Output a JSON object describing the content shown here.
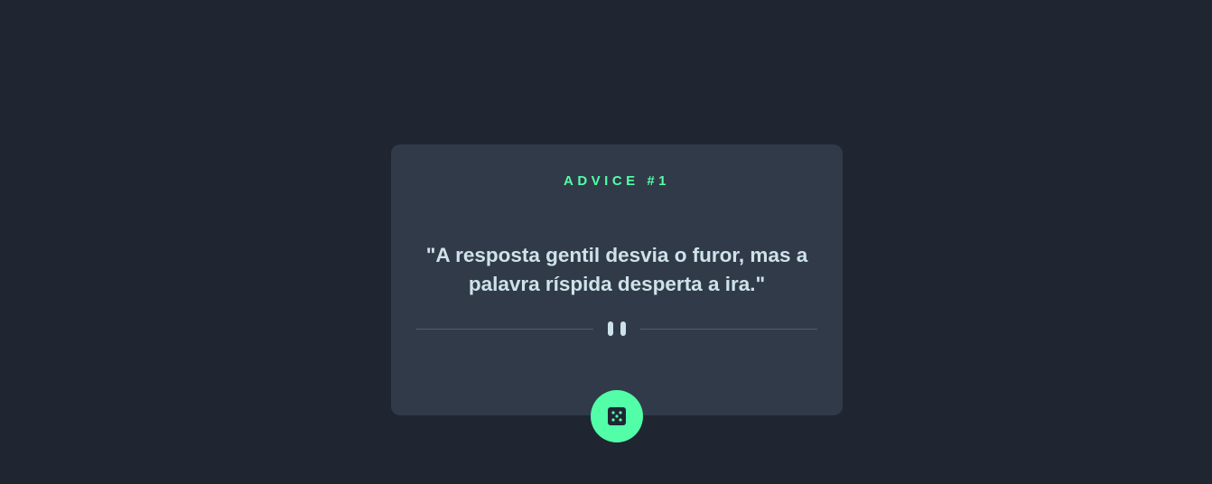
{
  "card": {
    "advice_label": "ADVICE #1",
    "quote": "\"A resposta gentil desvia o furor, mas a palavra ríspida desperta a ira.\""
  },
  "icons": {
    "divider": "pause-icon",
    "button": "dice-icon"
  },
  "colors": {
    "background": "#1f2631",
    "card": "#313a48",
    "accent": "#52ffa8",
    "text": "#cee3e9",
    "divider": "#4f5d74"
  }
}
